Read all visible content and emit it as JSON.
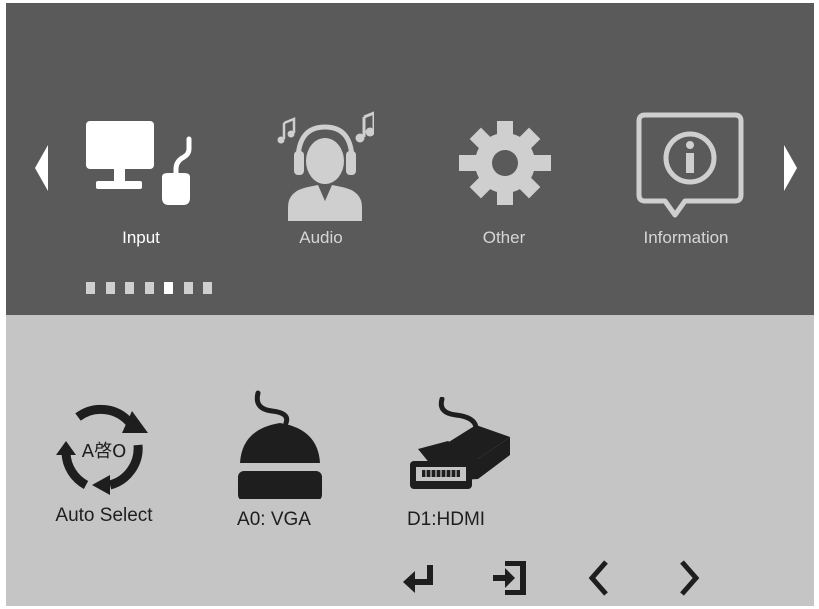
{
  "menu": {
    "prev_icon": "triangle-left-icon",
    "next_icon": "triangle-right-icon",
    "tabs": [
      {
        "label": "Input",
        "icon": "monitor-input-icon",
        "selected": true
      },
      {
        "label": "Audio",
        "icon": "headphones-person-icon",
        "selected": false
      },
      {
        "label": "Other",
        "icon": "gear-icon",
        "selected": false
      },
      {
        "label": "Information",
        "icon": "info-speech-bubble-icon",
        "selected": false
      }
    ],
    "page_count": 7,
    "current_page": 5
  },
  "input_options": [
    {
      "label": "Auto Select",
      "icon": "auto-select-cycle-icon",
      "icon_text": "A啓O"
    },
    {
      "label": "A0: VGA",
      "icon": "vga-connector-icon"
    },
    {
      "label": "D1:HDMI",
      "icon": "hdmi-connector-icon"
    }
  ],
  "footer_buttons": [
    {
      "icon": "enter-icon"
    },
    {
      "icon": "exit-icon"
    },
    {
      "icon": "chevron-left-icon"
    },
    {
      "icon": "chevron-right-icon"
    }
  ],
  "colors": {
    "top_panel": "#5a5a5a",
    "bottom_panel": "#c5c5c5",
    "selected_icon": "#ffffff",
    "unselected_icon": "#cfcfcf",
    "option_icon": "#1e1e1e"
  }
}
